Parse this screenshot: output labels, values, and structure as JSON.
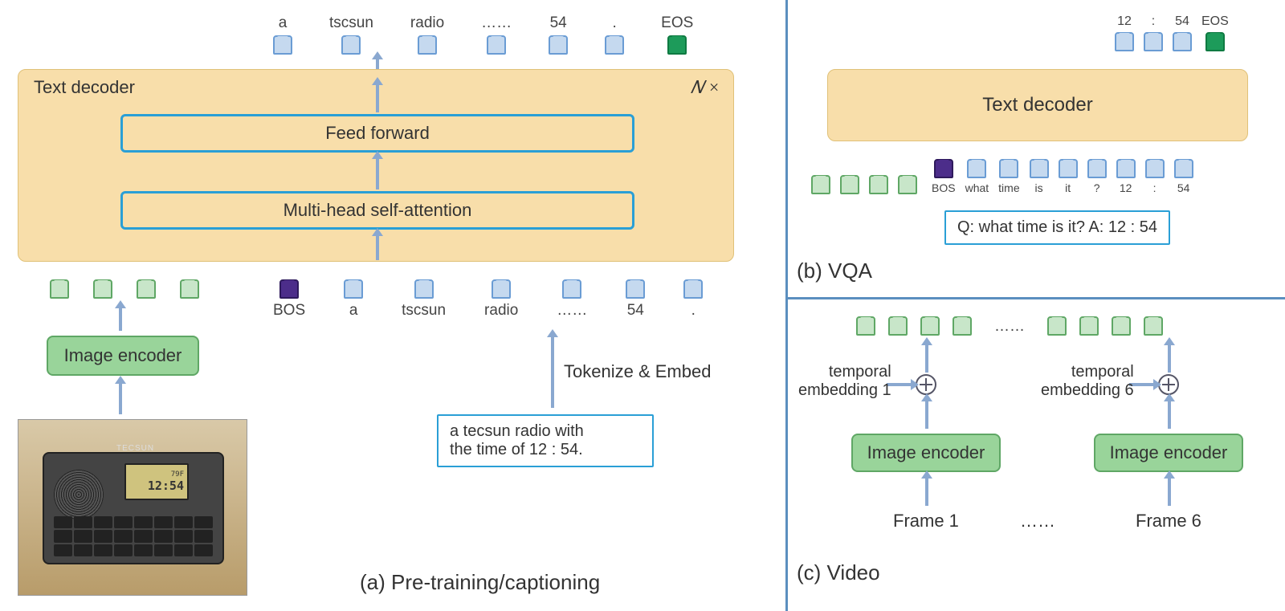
{
  "panelA": {
    "caption": "(a) Pre-training/captioning",
    "decoder": {
      "title": "Text decoder",
      "feedforward": "Feed forward",
      "attention": "Multi-head self-attention",
      "repeat": "𝑁 ×"
    },
    "encoder": "Image encoder",
    "tokenize_label": "Tokenize & Embed",
    "caption_text": "a tecsun radio with\nthe time of 12 : 54.",
    "output_tokens": [
      "a",
      "tscsun",
      "radio",
      "……",
      "54",
      ".",
      "EOS"
    ],
    "input_tokens": [
      "BOS",
      "a",
      "tscsun",
      "radio",
      "……",
      "54",
      "."
    ],
    "radio_brand": "TECSUN",
    "radio_time1": "79F",
    "radio_time2": "12:54"
  },
  "panelB": {
    "title": "(b) VQA",
    "decoder": "Text decoder",
    "output_tokens": [
      "12",
      ":",
      "54",
      "EOS"
    ],
    "input_tokens_img": 4,
    "input_tokens": [
      "BOS",
      "what",
      "time",
      "is",
      "it",
      "?",
      "12",
      ":",
      "54"
    ],
    "qa": "Q: what time is it? A: 12 : 54"
  },
  "panelC": {
    "title": "(c) Video",
    "ellipsis": "……",
    "temporal1": "temporal\nembedding 1",
    "temporal6": "temporal\nembedding 6",
    "encoder": "Image encoder",
    "frame1": "Frame 1",
    "frame6": "Frame 6",
    "tokens_per_frame": 4
  }
}
